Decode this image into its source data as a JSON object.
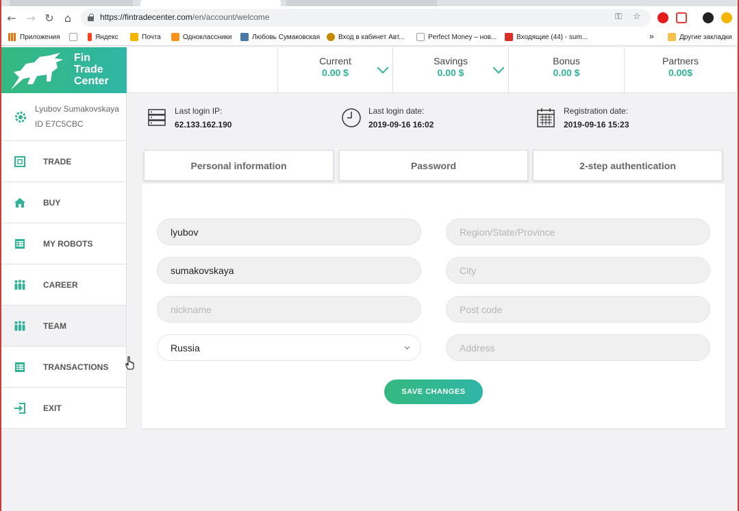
{
  "browser": {
    "url_host": "https://fintradecenter.com",
    "url_path": "/en/account/welcome",
    "bookmarks": [
      {
        "label": "Приложения",
        "color": "#e8710a"
      },
      {
        "label": "",
        "color": "#9aa0a6"
      },
      {
        "label": "Яндекс",
        "color": "#fc3f1d"
      },
      {
        "label": "Почта",
        "color": "#f4b400"
      },
      {
        "label": "Одноклассники",
        "color": "#f7931e"
      },
      {
        "label": "Любовь Сумаковская",
        "color": "#4a76a8"
      },
      {
        "label": "Вход в кабинет Авт...",
        "color": "#c58b00"
      },
      {
        "label": "Perfect Money – нов...",
        "color": "#9aa0a6"
      },
      {
        "label": "Входящие (44) - sum...",
        "color": "#d93025"
      }
    ],
    "bookmarks_more": "»",
    "other_bookmarks": "Другие закладки"
  },
  "brand": {
    "logo_lines": [
      "Fin",
      "Trade",
      "Center"
    ],
    "accent": "#2fb396"
  },
  "balances": [
    {
      "label": "Current",
      "value": "0.00 $",
      "dropdown": true
    },
    {
      "label": "Savings",
      "value": "0.00 $",
      "dropdown": true
    },
    {
      "label": "Bonus",
      "value": "0.00 $",
      "dropdown": false
    },
    {
      "label": "Partners",
      "value": "0.00$",
      "dropdown": false
    }
  ],
  "user": {
    "name": "Lyubov Sumakovskaya",
    "id": "ID E7C5CBC"
  },
  "nav": [
    {
      "label": "TRADE",
      "icon": "trade-icon"
    },
    {
      "label": "BUY",
      "icon": "home-icon"
    },
    {
      "label": "MY ROBOTS",
      "icon": "list-icon"
    },
    {
      "label": "CAREER",
      "icon": "people-icon"
    },
    {
      "label": "TEAM",
      "icon": "people-icon",
      "active": true
    },
    {
      "label": "TRANSACTIONS",
      "icon": "list-icon"
    },
    {
      "label": "EXIT",
      "icon": "exit-icon"
    }
  ],
  "info": {
    "ip_label": "Last login IP:",
    "ip_value": "62.133.162.190",
    "date_label": "Last login date:",
    "date_value": "2019-09-16 16:02",
    "reg_label": "Registration date:",
    "reg_value": "2019-09-16 15:23"
  },
  "tabs": [
    "Personal information",
    "Password",
    "2-step authentication"
  ],
  "form": {
    "first_name": "lyubov",
    "last_name": "sumakovskaya",
    "nickname_placeholder": "nickname",
    "country": "Russia",
    "region_placeholder": "Region/State/Province",
    "city_placeholder": "City",
    "postcode_placeholder": "Post code",
    "address_placeholder": "Address",
    "save_label": "SAVE CHANGES"
  }
}
